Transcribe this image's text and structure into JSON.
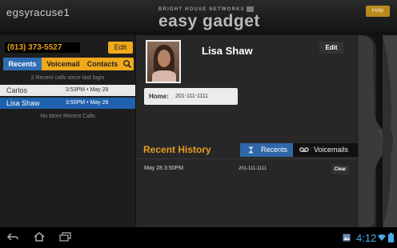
{
  "header": {
    "account": "egsyracuse1",
    "brand": "BRIGHT HOUSE NETWORKS",
    "product": "easy gadget",
    "help_label": "Help"
  },
  "sidebar": {
    "phone_number": "(813) 373-5527",
    "edit_label": "Edit",
    "tabs": [
      {
        "label": "Recents",
        "active": true
      },
      {
        "label": "Voicemail",
        "active": false
      },
      {
        "label": "Contacts",
        "active": false
      }
    ],
    "search_icon": "search-icon",
    "recent_summary": "2 Recent calls since last login",
    "calls": [
      {
        "name": "Carlos",
        "time": "3:53PM • May 28",
        "selected": false
      },
      {
        "name": "Lisa Shaw",
        "time": "3:50PM • May 28",
        "selected": true
      }
    ],
    "no_more_label": "No More Recent Calls"
  },
  "contact": {
    "name": "Lisa Shaw",
    "edit_label": "Edit",
    "home_label": "Home:",
    "home_value": "201-111-1111"
  },
  "history": {
    "title": "Recent History",
    "tabs": [
      {
        "label": "Recents",
        "icon": "hourglass-icon",
        "active": true
      },
      {
        "label": "Voicemails",
        "icon": "voicemail-icon",
        "active": false
      }
    ],
    "entries": [
      {
        "datetime": "May 28 3:50PM",
        "number": "201-111-1111",
        "action": "Clear"
      }
    ]
  },
  "system_bar": {
    "time": "4:12",
    "icons": [
      "back-icon",
      "home-icon",
      "recent-apps-icon",
      "gallery-icon",
      "wifi-icon",
      "battery-icon"
    ]
  },
  "colors": {
    "accent_orange": "#f0a81c",
    "selected_blue": "#1f61ad",
    "clock_blue": "#4aa9e6"
  }
}
